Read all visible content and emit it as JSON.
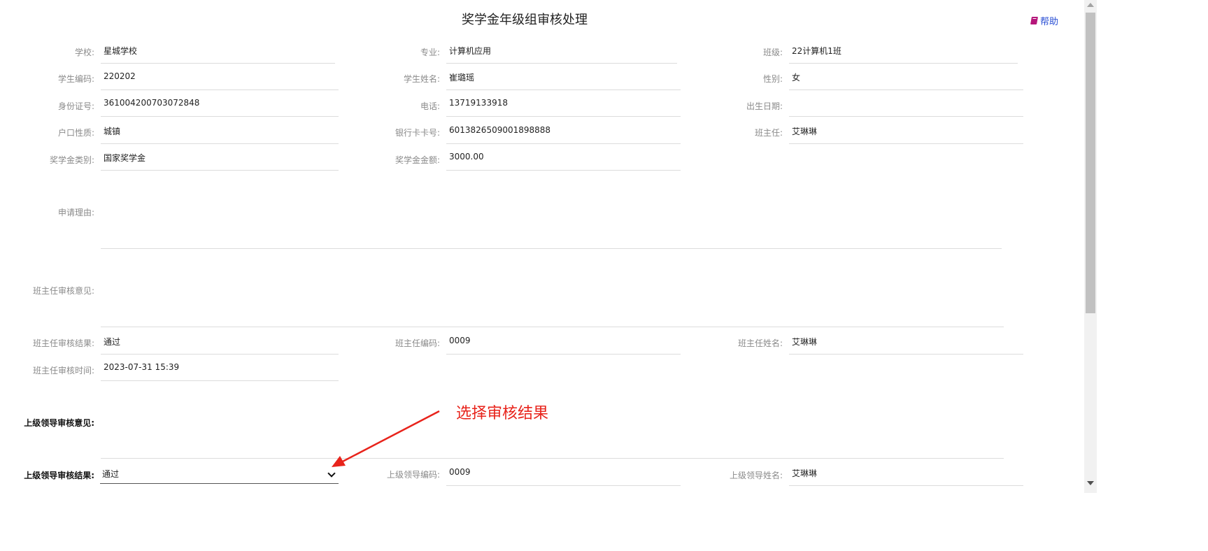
{
  "title": "奖学金年级组审核处理",
  "help": {
    "label": "帮助",
    "icon": "book-icon"
  },
  "fields": {
    "school": {
      "label": "学校:",
      "value": "星城学校"
    },
    "major": {
      "label": "专业:",
      "value": "计算机应用"
    },
    "class": {
      "label": "班级:",
      "value": "22计算机1班"
    },
    "student_code": {
      "label": "学生编码:",
      "value": "220202"
    },
    "student_name": {
      "label": "学生姓名:",
      "value": "崔璐瑶"
    },
    "gender": {
      "label": "性别:",
      "value": "女"
    },
    "id_number": {
      "label": "身份证号:",
      "value": "361004200703072848"
    },
    "phone": {
      "label": "电话:",
      "value": "13719133918"
    },
    "birth_date": {
      "label": "出生日期:",
      "value": ""
    },
    "hukou": {
      "label": "户口性质:",
      "value": "城镇"
    },
    "bank_card": {
      "label": "银行卡卡号:",
      "value": "6013826509001898888"
    },
    "head_teacher": {
      "label": "班主任:",
      "value": "艾琳琳"
    },
    "scholarship_type": {
      "label": "奖学金类别:",
      "value": "国家奖学金"
    },
    "scholarship_amount": {
      "label": "奖学金金额:",
      "value": "3000.00"
    },
    "reason": {
      "label": "申请理由:",
      "value": ""
    },
    "teacher_opinion": {
      "label": "班主任审核意见:",
      "value": ""
    },
    "teacher_result": {
      "label": "班主任审核结果:",
      "value": "通过"
    },
    "teacher_code": {
      "label": "班主任编码:",
      "value": "0009"
    },
    "teacher_name": {
      "label": "班主任姓名:",
      "value": "艾琳琳"
    },
    "teacher_time": {
      "label": "班主任审核时间:",
      "value": "2023-07-31 15:39"
    },
    "leader_opinion": {
      "label": "上级领导审核意见:",
      "value": ""
    },
    "leader_result": {
      "label": "上级领导审核结果:",
      "value": "通过"
    },
    "leader_code": {
      "label": "上级领导编码:",
      "value": "0009"
    },
    "leader_name": {
      "label": "上级领导姓名:",
      "value": "艾琳琳"
    }
  },
  "annotation": {
    "text": "选择审核结果",
    "color": "#e8231b"
  }
}
